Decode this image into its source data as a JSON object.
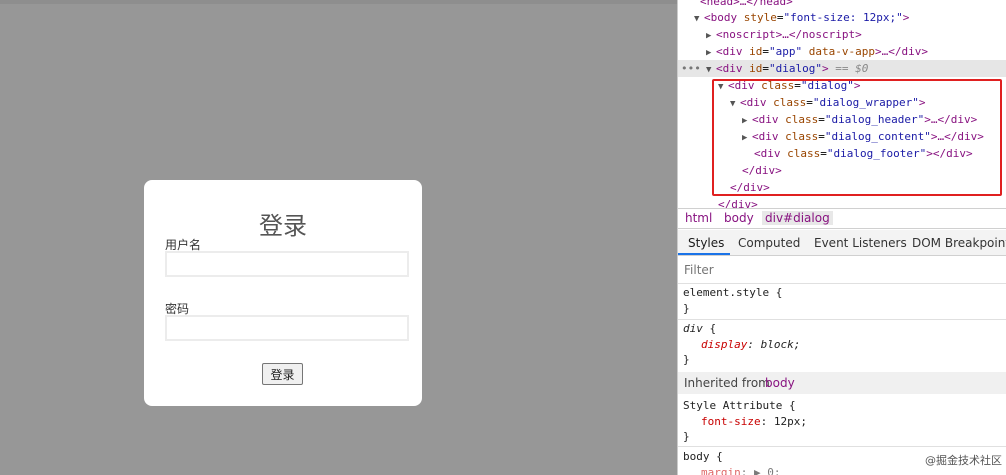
{
  "login_dialog": {
    "title": "登录",
    "username_label": "用户名",
    "password_label": "密码",
    "submit_label": "登录"
  },
  "devtools": {
    "dom": {
      "head_line": "<head>…</head>",
      "body_open": "body",
      "body_attr": "style",
      "body_attr_val": "\"font-size: 12px;\"",
      "noscript": "noscript",
      "noscript_end": ">…</noscript>",
      "app_div": "div",
      "app_attr": "id",
      "app_val": "\"app\"",
      "app_rest": "data-v-app",
      "app_end": ">…</div>",
      "dialog_div": "div",
      "dialog_attr": "id",
      "dialog_val": "\"dialog\"",
      "dialog_marker": "== $0",
      "ellipsis": "•••",
      "cls": "class",
      "dialog_class": "\"dialog\"",
      "wrapper_class": "\"dialog_wrapper\"",
      "header_class": "\"dialog_header\"",
      "content_class": "\"dialog_content\"",
      "footer_class": "\"dialog_footer\"",
      "collapsed_end": ">…</div>",
      "open_end": ">",
      "empty_close": "></div>",
      "close_div": "</div>",
      "close_div_cut": "</div>"
    },
    "breadcrumbs": [
      "html",
      "body",
      "div#dialog"
    ],
    "tabs": [
      "Styles",
      "Computed",
      "Event Listeners",
      "DOM Breakpoints"
    ],
    "filter_placeholder": "Filter",
    "styles": {
      "element_style": "element.style {",
      "close": "}",
      "div_selector": "div",
      "open_brace": " {",
      "display_prop": "display",
      "display_val": ": block;",
      "inherited_label": "Inherited from",
      "inherited_from": "body",
      "style_attr": "Style Attribute {",
      "font_size_prop": "font-size",
      "font_size_val": ": 12px;",
      "body_rule": "body {",
      "margin_prop": "margin",
      "margin_val": ": ▶ 0;"
    },
    "watermark": "@掘金技术社区"
  }
}
